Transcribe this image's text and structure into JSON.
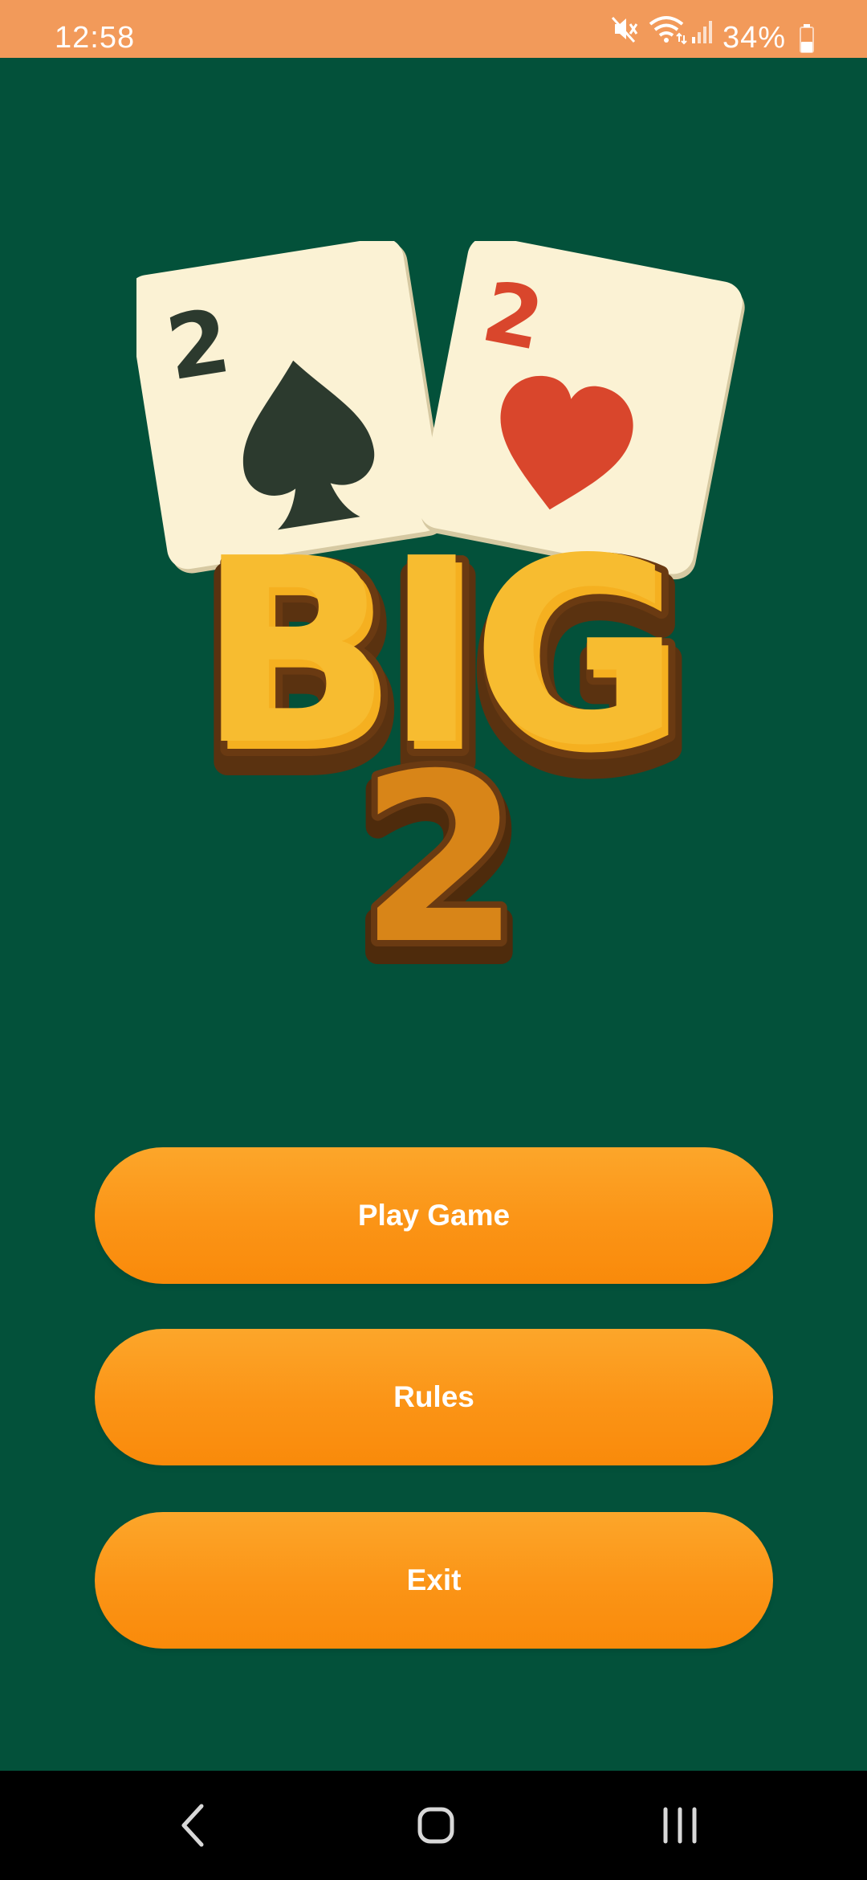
{
  "status_bar": {
    "time": "12:58",
    "battery_percent": "34%",
    "icons": [
      "mute-icon",
      "wifi-icon",
      "signal-icon",
      "battery-icon"
    ]
  },
  "logo": {
    "cards": [
      {
        "rank": "2",
        "suit": "spade",
        "color": "#2c3a2e"
      },
      {
        "rank": "2",
        "suit": "heart",
        "color": "#d9462c"
      }
    ],
    "title_word": "BIG",
    "title_number": "2"
  },
  "menu": {
    "play_label": "Play Game",
    "rules_label": "Rules",
    "exit_label": "Exit"
  },
  "navigation": {
    "icons": [
      "back-icon",
      "home-icon",
      "recent-apps-icon"
    ]
  },
  "colors": {
    "background": "#03513a",
    "status_bar": "#f29a5a",
    "button": "#fb9416",
    "logo_gold": "#f5b020",
    "logo_outline": "#6a3a12"
  }
}
